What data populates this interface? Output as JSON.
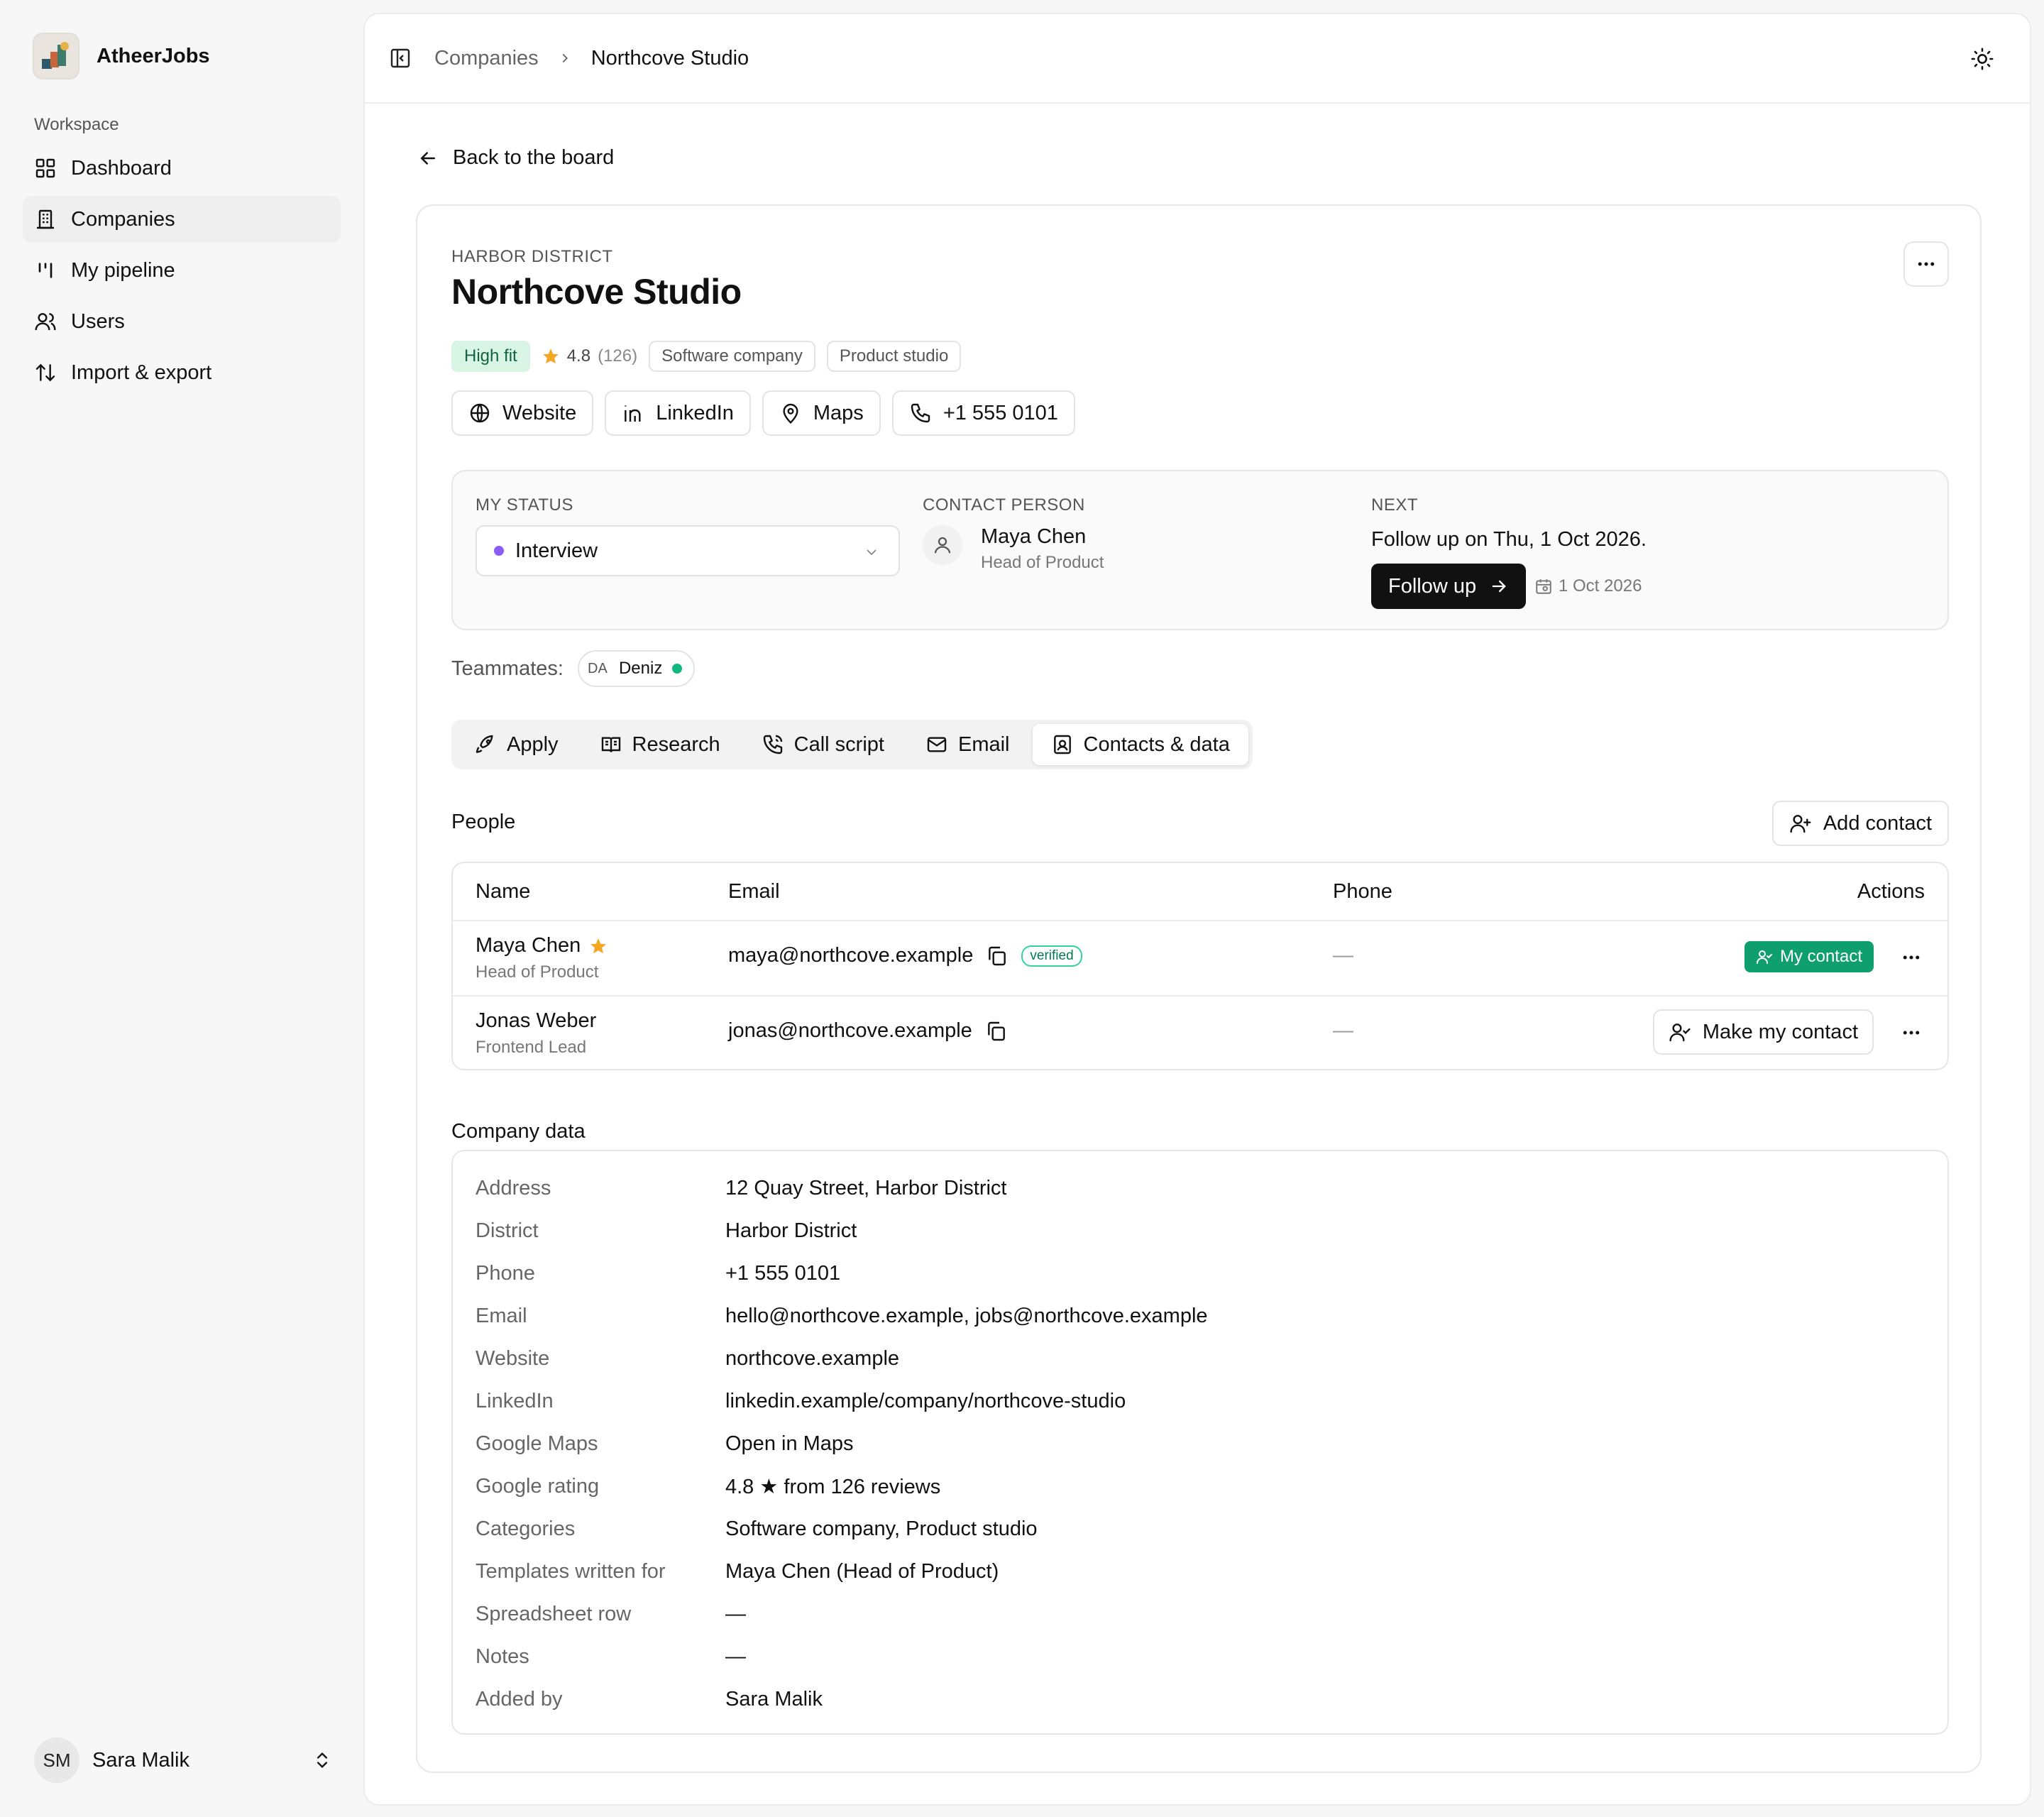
{
  "app": {
    "name": "AtheerJobs"
  },
  "sidebar": {
    "section_label": "Workspace",
    "items": [
      {
        "label": "Dashboard",
        "icon": "grid-icon"
      },
      {
        "label": "Companies",
        "icon": "building-icon",
        "active": true
      },
      {
        "label": "My pipeline",
        "icon": "pipeline-icon"
      },
      {
        "label": "Users",
        "icon": "users-icon"
      },
      {
        "label": "Import & export",
        "icon": "sort-arrows-icon"
      }
    ],
    "user": {
      "initials": "SM",
      "name": "Sara Malik"
    }
  },
  "breadcrumb": {
    "parent": "Companies",
    "current": "Northcove Studio"
  },
  "back_label": "Back to the board",
  "company": {
    "district": "HARBOR DISTRICT",
    "name": "Northcove Studio",
    "fit": "High fit",
    "rating": "4.8",
    "reviews": "(126)",
    "tags": [
      "Software company",
      "Product studio"
    ],
    "links": [
      "Website",
      "LinkedIn",
      "Maps",
      "+1 555 0101"
    ]
  },
  "status": {
    "my_status_label": "MY STATUS",
    "my_status_value": "Interview",
    "contact_label": "CONTACT PERSON",
    "contact_name": "Maya Chen",
    "contact_role": "Head of Product",
    "next_label": "NEXT",
    "next_text": "Follow up on Thu, 1 Oct 2026.",
    "follow_button": "Follow up",
    "follow_date": "1 Oct 2026"
  },
  "teammates": {
    "label": "Teammates:",
    "initials": "DA",
    "name": "Deniz"
  },
  "tabs": [
    "Apply",
    "Research",
    "Call script",
    "Email",
    "Contacts & data"
  ],
  "people": {
    "title": "People",
    "add_button": "Add contact",
    "headers": {
      "name": "Name",
      "email": "Email",
      "phone": "Phone",
      "actions": "Actions"
    },
    "rows": [
      {
        "name": "Maya Chen",
        "role": "Head of Product",
        "email": "maya@northcove.example",
        "verified": "verified",
        "phone": "—",
        "action": "My contact"
      },
      {
        "name": "Jonas Weber",
        "role": "Frontend Lead",
        "email": "jonas@northcove.example",
        "phone": "—",
        "action": "Make my contact"
      }
    ]
  },
  "company_data": {
    "title": "Company data",
    "rows": [
      {
        "key": "Address",
        "value": "12 Quay Street, Harbor District"
      },
      {
        "key": "District",
        "value": "Harbor District"
      },
      {
        "key": "Phone",
        "value": "+1 555 0101"
      },
      {
        "key": "Email",
        "value": "hello@northcove.example, jobs@northcove.example"
      },
      {
        "key": "Website",
        "value": "northcove.example"
      },
      {
        "key": "LinkedIn",
        "value": "linkedin.example/company/northcove-studio"
      },
      {
        "key": "Google Maps",
        "value": "Open in Maps"
      },
      {
        "key": "Google rating",
        "value": "4.8 ★ from 126 reviews"
      },
      {
        "key": "Categories",
        "value": "Software company, Product studio"
      },
      {
        "key": "Templates written for",
        "value": "Maya Chen (Head of Product)"
      },
      {
        "key": "Spreadsheet row",
        "value": "—"
      },
      {
        "key": "Notes",
        "value": "—"
      },
      {
        "key": "Added by",
        "value": "Sara Malik"
      }
    ]
  },
  "colors": {
    "fit_bg": "#d7f4e4",
    "my_contact": "#0f9f6e",
    "status_dot": "#8b5cf6",
    "online_dot": "#10b981"
  }
}
